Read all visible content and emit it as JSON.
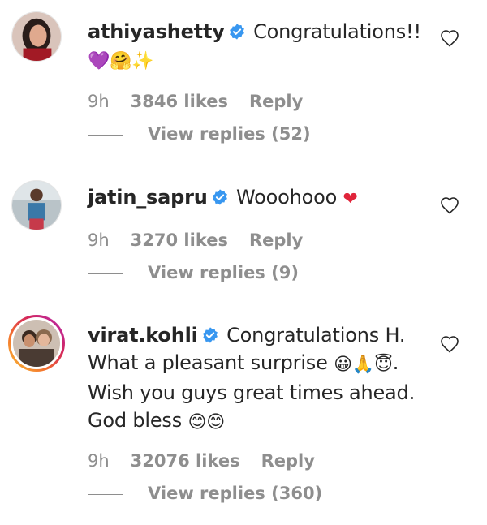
{
  "comments": [
    {
      "username": "athiyashetty",
      "text": "Congratulations!!",
      "emojis": "💜🤗✨",
      "time": "9h",
      "likes": "3846 likes",
      "reply_label": "Reply",
      "view_replies": "View replies (52)"
    },
    {
      "username": "jatin_sapru",
      "text": "Wooohooo",
      "emojis": "❤",
      "time": "9h",
      "likes": "3270 likes",
      "reply_label": "Reply",
      "view_replies": "View replies (9)"
    },
    {
      "username": "virat.kohli",
      "text_line1": "Congratulations H.",
      "text_line2": "What a pleasant surprise",
      "emojis_line2": "😀🙏😇",
      "text_line2_end": ".",
      "text_line3": "Wish you guys great times ahead.",
      "text_line4": "God bless",
      "emojis_line4": "😊😊",
      "time": "9h",
      "likes": "32076 likes",
      "reply_label": "Reply",
      "view_replies": "View replies (360)"
    }
  ],
  "icons": {
    "verified": "verified-badge-icon",
    "like": "heart-outline-icon"
  },
  "colors": {
    "verified_blue": "#3897f0",
    "meta_gray": "#8e8e8e",
    "text": "#262626"
  }
}
